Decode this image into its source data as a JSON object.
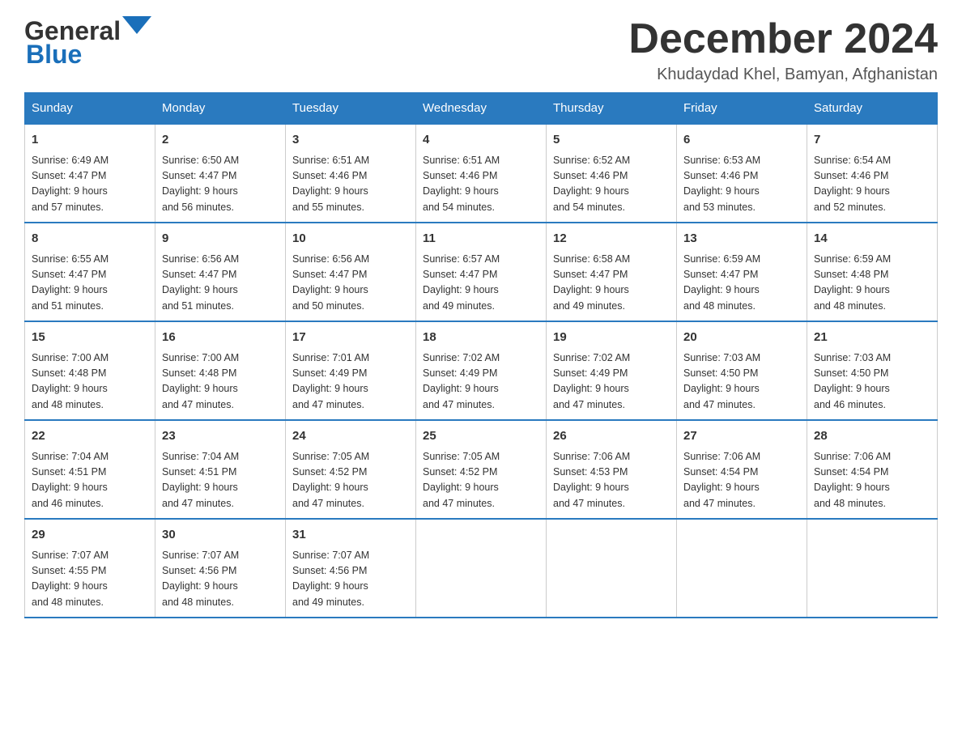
{
  "header": {
    "logo_general": "General",
    "logo_blue": "Blue",
    "month_title": "December 2024",
    "location": "Khudaydad Khel, Bamyan, Afghanistan"
  },
  "weekdays": [
    "Sunday",
    "Monday",
    "Tuesday",
    "Wednesday",
    "Thursday",
    "Friday",
    "Saturday"
  ],
  "weeks": [
    [
      {
        "day": "1",
        "sunrise": "6:49 AM",
        "sunset": "4:47 PM",
        "daylight": "9 hours and 57 minutes."
      },
      {
        "day": "2",
        "sunrise": "6:50 AM",
        "sunset": "4:47 PM",
        "daylight": "9 hours and 56 minutes."
      },
      {
        "day": "3",
        "sunrise": "6:51 AM",
        "sunset": "4:46 PM",
        "daylight": "9 hours and 55 minutes."
      },
      {
        "day": "4",
        "sunrise": "6:51 AM",
        "sunset": "4:46 PM",
        "daylight": "9 hours and 54 minutes."
      },
      {
        "day": "5",
        "sunrise": "6:52 AM",
        "sunset": "4:46 PM",
        "daylight": "9 hours and 54 minutes."
      },
      {
        "day": "6",
        "sunrise": "6:53 AM",
        "sunset": "4:46 PM",
        "daylight": "9 hours and 53 minutes."
      },
      {
        "day": "7",
        "sunrise": "6:54 AM",
        "sunset": "4:46 PM",
        "daylight": "9 hours and 52 minutes."
      }
    ],
    [
      {
        "day": "8",
        "sunrise": "6:55 AM",
        "sunset": "4:47 PM",
        "daylight": "9 hours and 51 minutes."
      },
      {
        "day": "9",
        "sunrise": "6:56 AM",
        "sunset": "4:47 PM",
        "daylight": "9 hours and 51 minutes."
      },
      {
        "day": "10",
        "sunrise": "6:56 AM",
        "sunset": "4:47 PM",
        "daylight": "9 hours and 50 minutes."
      },
      {
        "day": "11",
        "sunrise": "6:57 AM",
        "sunset": "4:47 PM",
        "daylight": "9 hours and 49 minutes."
      },
      {
        "day": "12",
        "sunrise": "6:58 AM",
        "sunset": "4:47 PM",
        "daylight": "9 hours and 49 minutes."
      },
      {
        "day": "13",
        "sunrise": "6:59 AM",
        "sunset": "4:47 PM",
        "daylight": "9 hours and 48 minutes."
      },
      {
        "day": "14",
        "sunrise": "6:59 AM",
        "sunset": "4:48 PM",
        "daylight": "9 hours and 48 minutes."
      }
    ],
    [
      {
        "day": "15",
        "sunrise": "7:00 AM",
        "sunset": "4:48 PM",
        "daylight": "9 hours and 48 minutes."
      },
      {
        "day": "16",
        "sunrise": "7:00 AM",
        "sunset": "4:48 PM",
        "daylight": "9 hours and 47 minutes."
      },
      {
        "day": "17",
        "sunrise": "7:01 AM",
        "sunset": "4:49 PM",
        "daylight": "9 hours and 47 minutes."
      },
      {
        "day": "18",
        "sunrise": "7:02 AM",
        "sunset": "4:49 PM",
        "daylight": "9 hours and 47 minutes."
      },
      {
        "day": "19",
        "sunrise": "7:02 AM",
        "sunset": "4:49 PM",
        "daylight": "9 hours and 47 minutes."
      },
      {
        "day": "20",
        "sunrise": "7:03 AM",
        "sunset": "4:50 PM",
        "daylight": "9 hours and 47 minutes."
      },
      {
        "day": "21",
        "sunrise": "7:03 AM",
        "sunset": "4:50 PM",
        "daylight": "9 hours and 46 minutes."
      }
    ],
    [
      {
        "day": "22",
        "sunrise": "7:04 AM",
        "sunset": "4:51 PM",
        "daylight": "9 hours and 46 minutes."
      },
      {
        "day": "23",
        "sunrise": "7:04 AM",
        "sunset": "4:51 PM",
        "daylight": "9 hours and 47 minutes."
      },
      {
        "day": "24",
        "sunrise": "7:05 AM",
        "sunset": "4:52 PM",
        "daylight": "9 hours and 47 minutes."
      },
      {
        "day": "25",
        "sunrise": "7:05 AM",
        "sunset": "4:52 PM",
        "daylight": "9 hours and 47 minutes."
      },
      {
        "day": "26",
        "sunrise": "7:06 AM",
        "sunset": "4:53 PM",
        "daylight": "9 hours and 47 minutes."
      },
      {
        "day": "27",
        "sunrise": "7:06 AM",
        "sunset": "4:54 PM",
        "daylight": "9 hours and 47 minutes."
      },
      {
        "day": "28",
        "sunrise": "7:06 AM",
        "sunset": "4:54 PM",
        "daylight": "9 hours and 48 minutes."
      }
    ],
    [
      {
        "day": "29",
        "sunrise": "7:07 AM",
        "sunset": "4:55 PM",
        "daylight": "9 hours and 48 minutes."
      },
      {
        "day": "30",
        "sunrise": "7:07 AM",
        "sunset": "4:56 PM",
        "daylight": "9 hours and 48 minutes."
      },
      {
        "day": "31",
        "sunrise": "7:07 AM",
        "sunset": "4:56 PM",
        "daylight": "9 hours and 49 minutes."
      },
      null,
      null,
      null,
      null
    ]
  ],
  "labels": {
    "sunrise": "Sunrise:",
    "sunset": "Sunset:",
    "daylight": "Daylight:"
  }
}
